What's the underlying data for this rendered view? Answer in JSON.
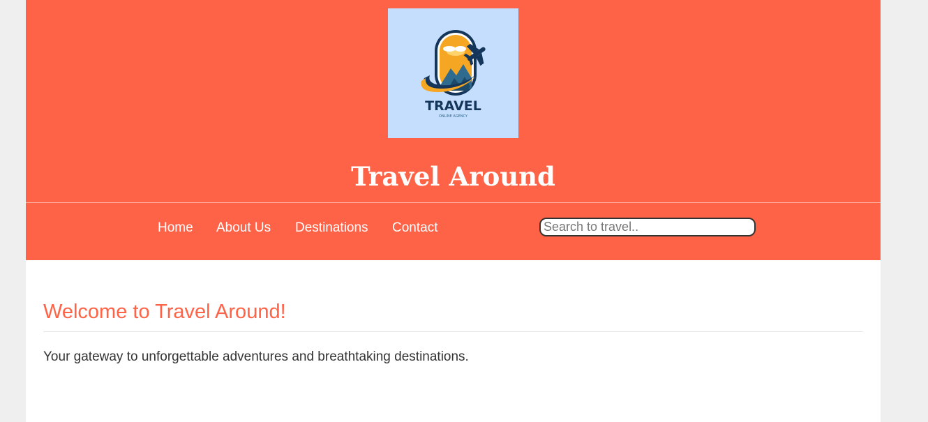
{
  "header": {
    "logo": {
      "icon": "travel-agency-logo",
      "wordmark": "TRAVEL",
      "tagline": "ONLINE AGENCY"
    },
    "site_title": "Travel Around"
  },
  "nav": {
    "links": [
      {
        "label": "Home"
      },
      {
        "label": "About Us"
      },
      {
        "label": "Destinations"
      },
      {
        "label": "Contact"
      }
    ],
    "search": {
      "placeholder": "Search to travel..",
      "value": ""
    }
  },
  "main": {
    "heading": "Welcome to Travel Around!",
    "intro": "Your gateway to unforgettable adventures and breathtaking destinations."
  },
  "colors": {
    "brand": "#ff6347",
    "logo_background": "#c6defd",
    "page_background": "#efefef",
    "content_background": "#ffffff",
    "body_text": "#333333"
  }
}
